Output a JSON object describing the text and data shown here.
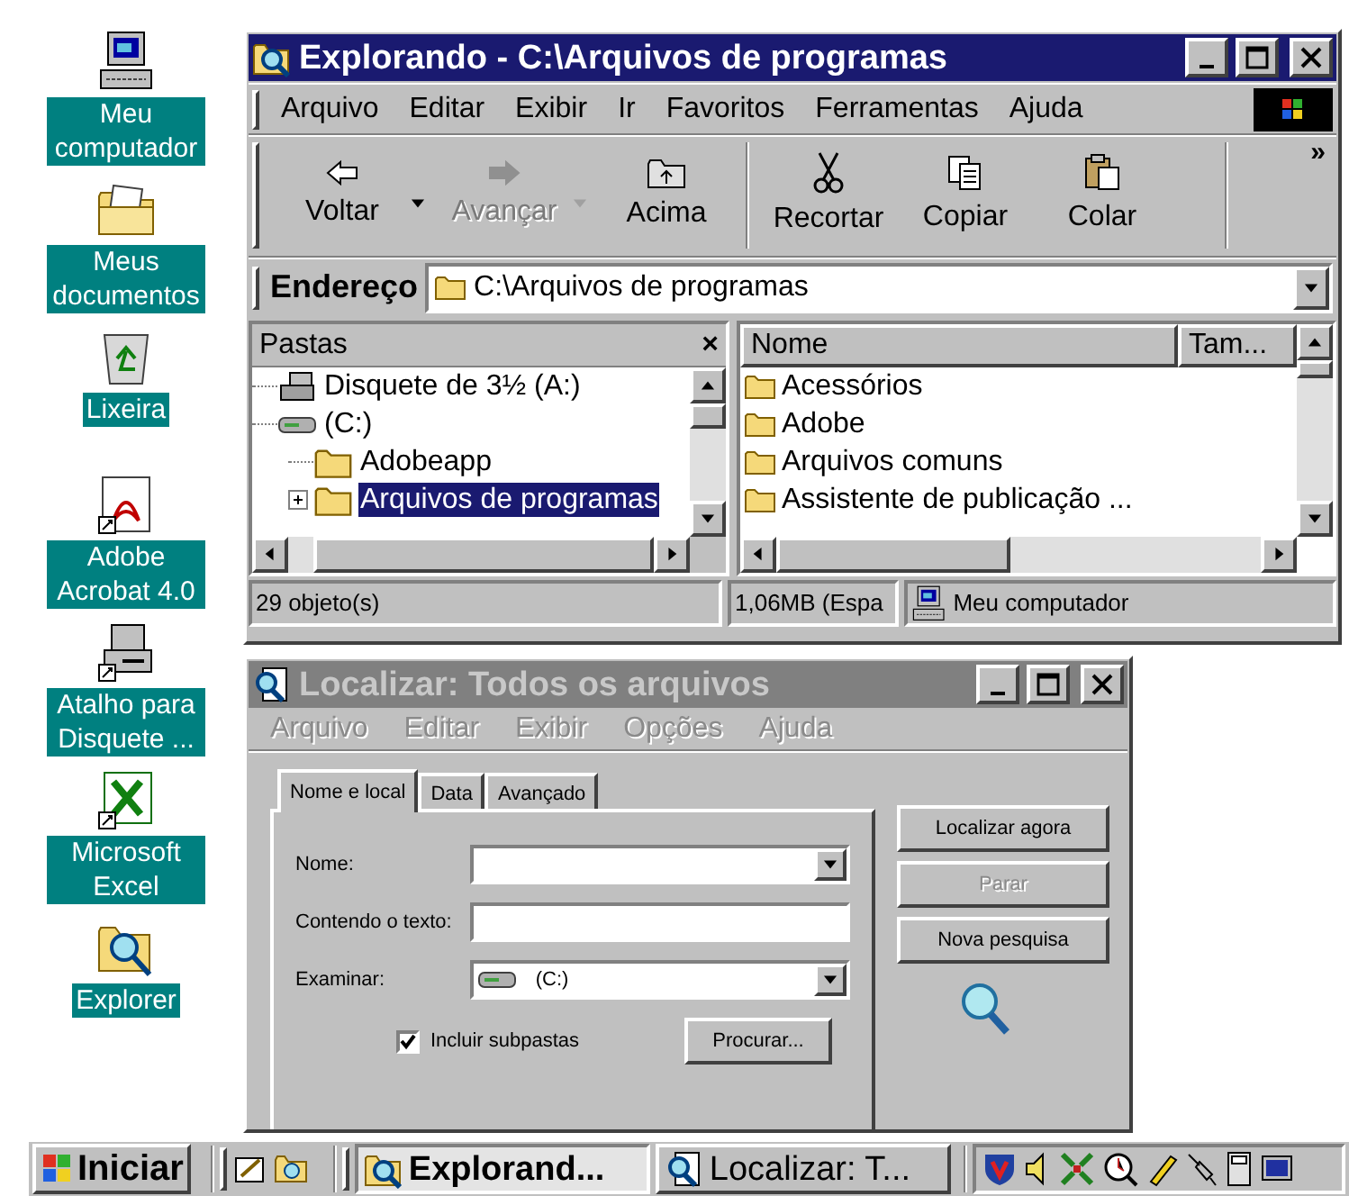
{
  "desktop_icons": [
    {
      "kind": "computer",
      "label": "Meu computador"
    },
    {
      "kind": "documents",
      "label": "Meus documentos"
    },
    {
      "kind": "recycle",
      "label": "Lixeira"
    },
    {
      "kind": "acrobat",
      "label": "Adobe Acrobat 4.0"
    },
    {
      "kind": "floppy",
      "label": "Atalho para Disquete ..."
    },
    {
      "kind": "excel",
      "label": "Microsoft Excel"
    },
    {
      "kind": "explorer",
      "label": "Explorer"
    }
  ],
  "explorer": {
    "title": "Explorando - C:\\Arquivos de programas",
    "active": true,
    "menu": [
      "Arquivo",
      "Editar",
      "Exibir",
      "Ir",
      "Favoritos",
      "Ferramentas",
      "Ajuda"
    ],
    "toolbar": [
      {
        "kind": "back",
        "label": "Voltar",
        "disabled": false,
        "dropdown": true,
        "separator_before": false
      },
      {
        "kind": "forward",
        "label": "Avançar",
        "disabled": true,
        "dropdown": true,
        "separator_before": false
      },
      {
        "kind": "up",
        "label": "Acima",
        "disabled": false,
        "dropdown": false,
        "separator_before": false
      },
      {
        "kind": "cut",
        "label": "Recortar",
        "disabled": false,
        "dropdown": false,
        "separator_before": true
      },
      {
        "kind": "copy",
        "label": "Copiar",
        "disabled": false,
        "dropdown": false,
        "separator_before": false
      },
      {
        "kind": "paste",
        "label": "Colar",
        "disabled": false,
        "dropdown": false,
        "separator_before": false
      }
    ],
    "toolbar_more": "»",
    "address": {
      "label": "Endereço",
      "value": "C:\\Arquivos de programas"
    },
    "folders": {
      "title": "Pastas",
      "close": "×",
      "tree": [
        {
          "kind": "floppy",
          "label": "Disquete de 3½ (A:)",
          "selected": false
        },
        {
          "kind": "drive",
          "label": "(C:)",
          "selected": false,
          "children": [
            {
              "kind": "folder",
              "label": "Adobeapp",
              "selected": false
            },
            {
              "kind": "folder",
              "label": "Arquivos de programas",
              "selected": true,
              "expanded": false
            }
          ]
        }
      ]
    },
    "list": {
      "columns": [
        "Nome",
        "Tam..."
      ],
      "rows": [
        "Acessórios",
        "Adobe",
        "Arquivos comuns",
        "Assistente de publicação ..."
      ]
    },
    "status_bar": [
      "29 objeto(s)",
      "1,06MB (Espa",
      "Meu computador"
    ]
  },
  "find": {
    "title": "Localizar: Todos os arquivos",
    "active": false,
    "menu": [
      "Arquivo",
      "Editar",
      "Exibir",
      "Opções",
      "Ajuda"
    ],
    "tabs": [
      {
        "label": "Nome e local",
        "selected": true
      },
      {
        "label": "Data",
        "selected": false
      },
      {
        "label": "Avançado",
        "selected": false
      }
    ],
    "fields": [
      {
        "kind": "combo",
        "label": "Nome:"
      },
      {
        "kind": "text",
        "label": "Contendo o texto:"
      },
      {
        "kind": "drive_combo",
        "label": "Examinar:",
        "value": "(C:)"
      }
    ],
    "include_subfolders": {
      "label": "Incluir subpastas",
      "checked": true
    },
    "browse_button": "Procurar...",
    "buttons": [
      {
        "label": "Localizar agora",
        "disabled": false
      },
      {
        "label": "Parar",
        "disabled": true
      },
      {
        "label": "Nova pesquisa",
        "disabled": false
      }
    ]
  },
  "taskbar": {
    "start": "Iniciar",
    "tasks": [
      {
        "kind": "explorer",
        "label": "Explorand...",
        "selected": true
      },
      {
        "kind": "find",
        "label": "Localizar: T...",
        "selected": false
      }
    ]
  }
}
